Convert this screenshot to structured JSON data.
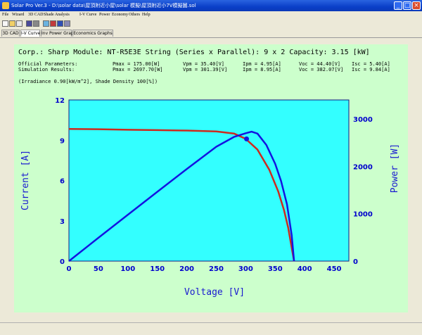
{
  "window": {
    "title": "Solar Pro Ver.3 - D:\\solar data\\屋頂附近小屋\\solar 模擬\\屋頂附近小7V模擬圖.sol",
    "controls": [
      "_",
      "□",
      "×"
    ]
  },
  "menu": [
    "File",
    "Wizard",
    "3D CAD",
    "Shade Analysis",
    "I-V Curve",
    "Power",
    "Economy",
    "Others",
    "Help"
  ],
  "toolbar_icons": [
    "new-icon",
    "open-icon",
    "close-icon",
    "save-icon",
    "print-icon",
    "view-icon",
    "chart-icon",
    "color-icon",
    "data-icon"
  ],
  "tabs": [
    {
      "label": "3D CAD",
      "active": false
    },
    {
      "label": "I-V Curve",
      "active": true
    },
    {
      "label": "Inv Power Graph",
      "active": false
    },
    {
      "label": "Economics Graphs",
      "active": false
    }
  ],
  "summary": {
    "header": "Corp.: Sharp  Module: NT-R5E3E  String (Series x Parallel): 9 x 2  Capacity: 3.15 [kW]",
    "official": {
      "label": "Official Parameters:",
      "pmax": "Pmax = 175.00[W]",
      "vpm": "Vpm = 35.40[V]",
      "ipm": "Ipm = 4.95[A]",
      "voc": "Voc = 44.40[V]",
      "isc": "Isc = 5.40[A]"
    },
    "simulation": {
      "label": "Simulation Results:",
      "pmax": "Pmax = 2697.70[W]",
      "vpm": "Vpm = 301.39[V]",
      "ipm": "Ipm = 8.95[A]",
      "voc": "Voc = 382.07[V]",
      "isc": "Isc = 9.84[A]"
    },
    "conditions": "(Irradiance 0.90[kW/m^2], Shade Density 100[%])"
  },
  "chart_data": {
    "type": "line",
    "xlabel": "Voltage [V]",
    "ylabel": "Current [A]",
    "y2label": "Power [W]",
    "xlim": [
      0,
      475
    ],
    "ylim": [
      0,
      12
    ],
    "y2lim": [
      0,
      3400
    ],
    "x_ticks": [
      0,
      50,
      100,
      150,
      200,
      250,
      300,
      350,
      400,
      450
    ],
    "y_ticks": [
      0,
      3,
      6,
      9,
      12
    ],
    "y2_ticks": [
      0,
      1000,
      2000,
      3000
    ],
    "colors": {
      "background": "#33ffff",
      "current": "#cc2a1e",
      "power": "#1414e0",
      "axis_text": "#0000cc",
      "label_text": "#1a1ad0"
    },
    "series": [
      {
        "axis": "left",
        "x": [
          0,
          50,
          100,
          150,
          200,
          250,
          280,
          300,
          320,
          340,
          355,
          365,
          372,
          378,
          382
        ],
        "values": [
          9.84,
          9.82,
          9.78,
          9.75,
          9.72,
          9.65,
          9.5,
          9.1,
          8.3,
          6.8,
          5.2,
          3.8,
          2.5,
          1.0,
          0
        ]
      },
      {
        "axis": "right",
        "x": [
          0,
          50,
          100,
          150,
          200,
          250,
          280,
          300,
          310,
          320,
          335,
          350,
          360,
          370,
          378,
          382
        ],
        "values": [
          0,
          491,
          978,
          1463,
          1944,
          2413,
          2619,
          2697,
          2730,
          2690,
          2450,
          2050,
          1690,
          1200,
          550,
          0
        ]
      }
    ],
    "marker": {
      "x": 301.39,
      "y": 9.1
    }
  }
}
